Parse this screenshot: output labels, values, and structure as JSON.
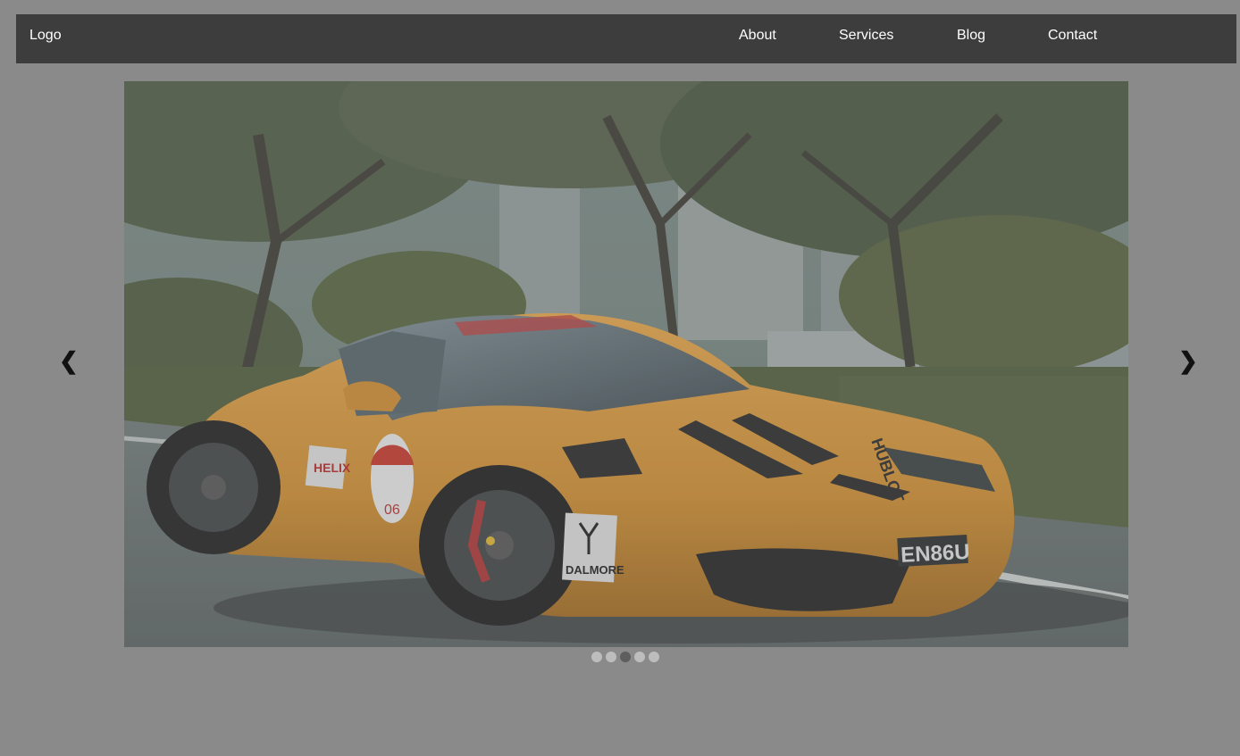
{
  "navbar": {
    "logo": "Logo",
    "links": [
      "About",
      "Services",
      "Blog",
      "Contact"
    ]
  },
  "slideshow": {
    "prev_arrow": "❮",
    "next_arrow": "❯",
    "dot_count": 5,
    "active_dot": 2,
    "image_subject": "orange sports car driving on tree-lined road",
    "car_plate": "EN86U",
    "sticker_brand": "DALMORE",
    "sticker_number": "06",
    "sticker_oil": "HELIX",
    "hood_text": "HUBLOT"
  },
  "colors": {
    "page_bg": "#8a8a8a",
    "navbar_bg": "#3d3d3d",
    "nav_text": "#ffffff",
    "car_body": "#d4932f",
    "dot_inactive": "#bdbdbd",
    "dot_active": "#5e5e5e"
  }
}
